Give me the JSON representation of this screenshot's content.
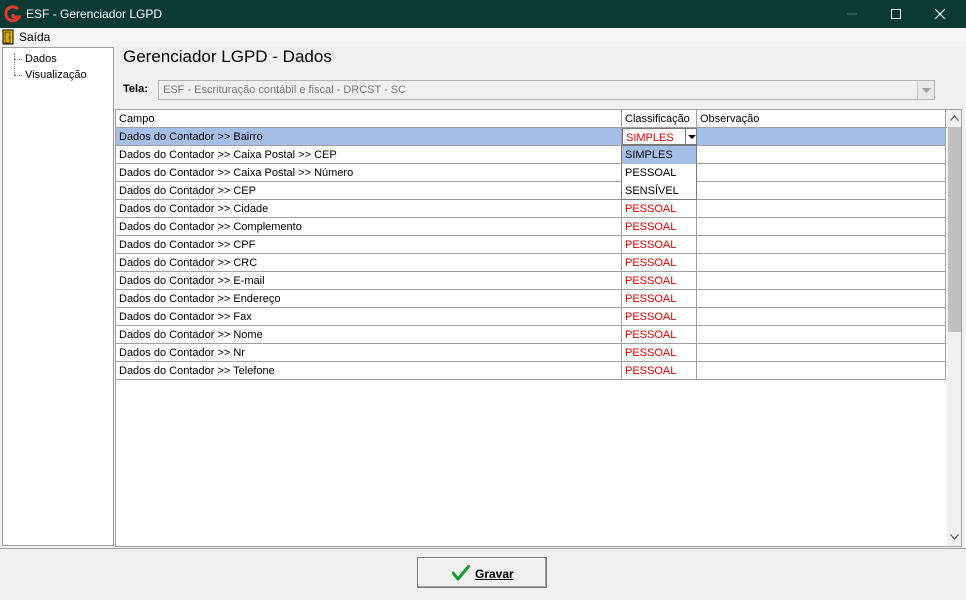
{
  "window": {
    "title": "ESF - Gerenciador LGPD",
    "titlebar_color": "#0b3a33",
    "logo_color": "#e23a2e"
  },
  "menu": {
    "exit_label": "Saída"
  },
  "tree": {
    "items": [
      "Dados",
      "Visualização"
    ]
  },
  "page": {
    "title": "Gerenciador LGPD - Dados",
    "tela_label": "Tela:",
    "tela_value": "ESF - Escrituração contábil e fiscal - DRCST - SC"
  },
  "grid": {
    "columns": [
      "Campo",
      "Classificação",
      "Observação"
    ],
    "rows": [
      {
        "campo": "Dados do Contador >> Bairro",
        "classificacao": "SIMPLES",
        "observacao": ""
      },
      {
        "campo": "Dados do Contador >> Caixa Postal >> CEP",
        "classificacao": "",
        "observacao": ""
      },
      {
        "campo": "Dados do Contador >> Caixa Postal >> Número",
        "classificacao": "",
        "observacao": ""
      },
      {
        "campo": "Dados do Contador >> CEP",
        "classificacao": "",
        "observacao": ""
      },
      {
        "campo": "Dados do Contador >> Cidade",
        "classificacao": "PESSOAL",
        "observacao": ""
      },
      {
        "campo": "Dados do Contador >> Complemento",
        "classificacao": "PESSOAL",
        "observacao": ""
      },
      {
        "campo": "Dados do Contador >> CPF",
        "classificacao": "PESSOAL",
        "observacao": ""
      },
      {
        "campo": "Dados do Contador >> CRC",
        "classificacao": "PESSOAL",
        "observacao": ""
      },
      {
        "campo": "Dados do Contador >> E-mail",
        "classificacao": "PESSOAL",
        "observacao": ""
      },
      {
        "campo": "Dados do Contador >> Endereço",
        "classificacao": "PESSOAL",
        "observacao": ""
      },
      {
        "campo": "Dados do Contador >> Fax",
        "classificacao": "PESSOAL",
        "observacao": ""
      },
      {
        "campo": "Dados do Contador >> Nome",
        "classificacao": "PESSOAL",
        "observacao": ""
      },
      {
        "campo": "Dados do Contador >> Nr",
        "classificacao": "PESSOAL",
        "observacao": ""
      },
      {
        "campo": "Dados do Contador >> Telefone",
        "classificacao": "PESSOAL",
        "observacao": ""
      }
    ],
    "selected_row": 0,
    "selection_color": "#a6bfe9",
    "classification_color": "#e00000"
  },
  "dropdown": {
    "options": [
      "SIMPLES",
      "PESSOAL",
      "SENSÍVEL"
    ],
    "selected": "SIMPLES"
  },
  "footer": {
    "save_label": "Gravar",
    "save_icon": "green-check-icon"
  }
}
